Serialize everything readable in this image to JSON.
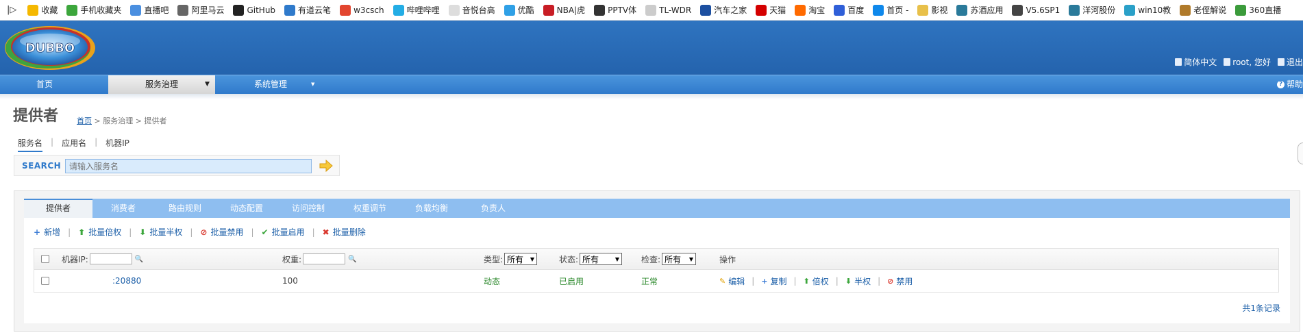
{
  "bookmarks": {
    "toggle": "|▷",
    "items": [
      {
        "label": "收藏",
        "icon": "star-icon",
        "color": "#f5b800"
      },
      {
        "label": "手机收藏夹",
        "icon": "phone-icon",
        "color": "#3ca63c"
      },
      {
        "label": "直播吧",
        "icon": "livebar-icon",
        "color": "#4a8fe0"
      },
      {
        "label": "阿里马云",
        "icon": "ali-icon",
        "color": "#666666"
      },
      {
        "label": "GitHub",
        "icon": "github-icon",
        "color": "#222222"
      },
      {
        "label": "有道云笔",
        "icon": "youdao-icon",
        "color": "#2f7acb"
      },
      {
        "label": "w3csch",
        "icon": "w3c-icon",
        "color": "#e2452f"
      },
      {
        "label": "哔哩哔哩",
        "icon": "bilibili-icon",
        "color": "#23ade5"
      },
      {
        "label": "音悦台高",
        "icon": "yinyue-icon",
        "color": "#dddddd"
      },
      {
        "label": "优酷",
        "icon": "youku-icon",
        "color": "#2fa0e6"
      },
      {
        "label": "NBA|虎",
        "icon": "hupu-icon",
        "color": "#c81d25"
      },
      {
        "label": "PPTV体",
        "icon": "pptv-icon",
        "color": "#333333"
      },
      {
        "label": "TL-WDR",
        "icon": "page-icon",
        "color": "#cccccc"
      },
      {
        "label": "汽车之家",
        "icon": "autohome-icon",
        "color": "#1c4fa0"
      },
      {
        "label": "天猫",
        "icon": "tmall-icon",
        "color": "#d40000"
      },
      {
        "label": "淘宝",
        "icon": "taobao-icon",
        "color": "#ff6a00"
      },
      {
        "label": "百度",
        "icon": "baidu-icon",
        "color": "#2f5fd8"
      },
      {
        "label": "首页 -",
        "icon": "zhihu-icon",
        "color": "#0f88eb"
      },
      {
        "label": "影视",
        "icon": "folder-icon",
        "color": "#e8c04a"
      },
      {
        "label": "苏酒应用",
        "icon": "globe-icon",
        "color": "#2a7a9a"
      },
      {
        "label": "V5.6SP1",
        "icon": "avi-icon",
        "color": "#444444"
      },
      {
        "label": "洋河股份",
        "icon": "globe-icon",
        "color": "#2a7a9a"
      },
      {
        "label": "win10教",
        "icon": "win-icon",
        "color": "#2aa0c8"
      },
      {
        "label": "老侄解说",
        "icon": "face-icon",
        "color": "#b07a2a"
      },
      {
        "label": "360直播",
        "icon": "360-icon",
        "color": "#3b9b3b"
      }
    ]
  },
  "header": {
    "logo_text": "DUBBO",
    "user_links": [
      {
        "label": "简体中文",
        "icon": "language-icon"
      },
      {
        "label": "root, 您好",
        "icon": "user-icon"
      },
      {
        "label": "退出",
        "icon": "logout-icon"
      }
    ]
  },
  "menu": {
    "items": [
      {
        "label": "首页"
      },
      {
        "label": "服务治理",
        "arrow": "▼"
      },
      {
        "label": "系统管理",
        "arrow": "▼"
      }
    ],
    "help": "帮助",
    "help_icon": "help-icon"
  },
  "page": {
    "title": "提供者",
    "breadcrumb_home": "首页",
    "breadcrumb_rest": " > 服务治理 > 提供者"
  },
  "search": {
    "tabs": [
      "服务名",
      "应用名",
      "机器IP"
    ],
    "label": "SEARCH",
    "placeholder": "请输入服务名"
  },
  "panel": {
    "tabs": [
      "提供者",
      "消费者",
      "路由规则",
      "动态配置",
      "访问控制",
      "权重调节",
      "负载均衡",
      "负责人"
    ],
    "toolbar": [
      {
        "label": "新增",
        "icon": "plus-icon",
        "glyph": "+",
        "color": "#3a7bd5"
      },
      {
        "label": "批量倍权",
        "icon": "arrow-up-icon",
        "glyph": "⬆",
        "color": "#3ca63c"
      },
      {
        "label": "批量半权",
        "icon": "arrow-down-icon",
        "glyph": "⬇",
        "color": "#3ca63c"
      },
      {
        "label": "批量禁用",
        "icon": "ban-icon",
        "glyph": "⊘",
        "color": "#d9372d"
      },
      {
        "label": "批量启用",
        "icon": "check-icon",
        "glyph": "✔",
        "color": "#3ca63c"
      },
      {
        "label": "批量删除",
        "icon": "delete-icon",
        "glyph": "✖",
        "color": "#d9372d"
      }
    ],
    "columns": {
      "ip_label": "机器IP:",
      "weight_label": "权重:",
      "type_label": "类型:",
      "type_value": "所有",
      "status_label": "状态:",
      "status_value": "所有",
      "check_label": "检查:",
      "check_value": "所有",
      "ops_label": "操作"
    },
    "rows": [
      {
        "address": ":20880",
        "weight": "100",
        "type": "动态",
        "status": "已启用",
        "check": "正常",
        "ops": [
          {
            "label": "编辑",
            "icon": "edit-icon",
            "glyph": "✎",
            "color": "#e0a000"
          },
          {
            "label": "复制",
            "icon": "plus-icon",
            "glyph": "+",
            "color": "#3a7bd5"
          },
          {
            "label": "倍权",
            "icon": "arrow-up-icon",
            "glyph": "⬆",
            "color": "#3ca63c"
          },
          {
            "label": "半权",
            "icon": "arrow-down-icon",
            "glyph": "⬇",
            "color": "#3ca63c"
          },
          {
            "label": "禁用",
            "icon": "ban-icon",
            "glyph": "⊘",
            "color": "#d9372d"
          }
        ]
      }
    ],
    "total": "共1条记录"
  }
}
